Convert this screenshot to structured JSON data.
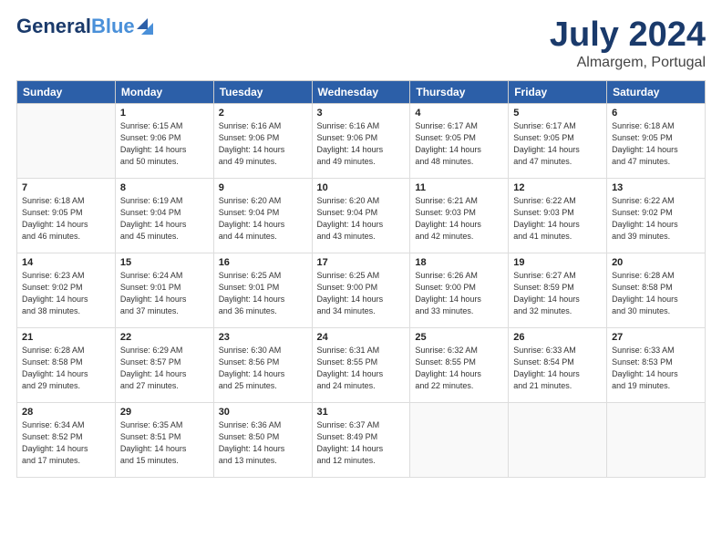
{
  "header": {
    "logo_general": "General",
    "logo_blue": "Blue",
    "main_title": "July 2024",
    "subtitle": "Almargem, Portugal"
  },
  "weekdays": [
    "Sunday",
    "Monday",
    "Tuesday",
    "Wednesday",
    "Thursday",
    "Friday",
    "Saturday"
  ],
  "weeks": [
    [
      {
        "day": "",
        "info": ""
      },
      {
        "day": "1",
        "info": "Sunrise: 6:15 AM\nSunset: 9:06 PM\nDaylight: 14 hours\nand 50 minutes."
      },
      {
        "day": "2",
        "info": "Sunrise: 6:16 AM\nSunset: 9:06 PM\nDaylight: 14 hours\nand 49 minutes."
      },
      {
        "day": "3",
        "info": "Sunrise: 6:16 AM\nSunset: 9:06 PM\nDaylight: 14 hours\nand 49 minutes."
      },
      {
        "day": "4",
        "info": "Sunrise: 6:17 AM\nSunset: 9:05 PM\nDaylight: 14 hours\nand 48 minutes."
      },
      {
        "day": "5",
        "info": "Sunrise: 6:17 AM\nSunset: 9:05 PM\nDaylight: 14 hours\nand 47 minutes."
      },
      {
        "day": "6",
        "info": "Sunrise: 6:18 AM\nSunset: 9:05 PM\nDaylight: 14 hours\nand 47 minutes."
      }
    ],
    [
      {
        "day": "7",
        "info": "Sunrise: 6:18 AM\nSunset: 9:05 PM\nDaylight: 14 hours\nand 46 minutes."
      },
      {
        "day": "8",
        "info": "Sunrise: 6:19 AM\nSunset: 9:04 PM\nDaylight: 14 hours\nand 45 minutes."
      },
      {
        "day": "9",
        "info": "Sunrise: 6:20 AM\nSunset: 9:04 PM\nDaylight: 14 hours\nand 44 minutes."
      },
      {
        "day": "10",
        "info": "Sunrise: 6:20 AM\nSunset: 9:04 PM\nDaylight: 14 hours\nand 43 minutes."
      },
      {
        "day": "11",
        "info": "Sunrise: 6:21 AM\nSunset: 9:03 PM\nDaylight: 14 hours\nand 42 minutes."
      },
      {
        "day": "12",
        "info": "Sunrise: 6:22 AM\nSunset: 9:03 PM\nDaylight: 14 hours\nand 41 minutes."
      },
      {
        "day": "13",
        "info": "Sunrise: 6:22 AM\nSunset: 9:02 PM\nDaylight: 14 hours\nand 39 minutes."
      }
    ],
    [
      {
        "day": "14",
        "info": "Sunrise: 6:23 AM\nSunset: 9:02 PM\nDaylight: 14 hours\nand 38 minutes."
      },
      {
        "day": "15",
        "info": "Sunrise: 6:24 AM\nSunset: 9:01 PM\nDaylight: 14 hours\nand 37 minutes."
      },
      {
        "day": "16",
        "info": "Sunrise: 6:25 AM\nSunset: 9:01 PM\nDaylight: 14 hours\nand 36 minutes."
      },
      {
        "day": "17",
        "info": "Sunrise: 6:25 AM\nSunset: 9:00 PM\nDaylight: 14 hours\nand 34 minutes."
      },
      {
        "day": "18",
        "info": "Sunrise: 6:26 AM\nSunset: 9:00 PM\nDaylight: 14 hours\nand 33 minutes."
      },
      {
        "day": "19",
        "info": "Sunrise: 6:27 AM\nSunset: 8:59 PM\nDaylight: 14 hours\nand 32 minutes."
      },
      {
        "day": "20",
        "info": "Sunrise: 6:28 AM\nSunset: 8:58 PM\nDaylight: 14 hours\nand 30 minutes."
      }
    ],
    [
      {
        "day": "21",
        "info": "Sunrise: 6:28 AM\nSunset: 8:58 PM\nDaylight: 14 hours\nand 29 minutes."
      },
      {
        "day": "22",
        "info": "Sunrise: 6:29 AM\nSunset: 8:57 PM\nDaylight: 14 hours\nand 27 minutes."
      },
      {
        "day": "23",
        "info": "Sunrise: 6:30 AM\nSunset: 8:56 PM\nDaylight: 14 hours\nand 25 minutes."
      },
      {
        "day": "24",
        "info": "Sunrise: 6:31 AM\nSunset: 8:55 PM\nDaylight: 14 hours\nand 24 minutes."
      },
      {
        "day": "25",
        "info": "Sunrise: 6:32 AM\nSunset: 8:55 PM\nDaylight: 14 hours\nand 22 minutes."
      },
      {
        "day": "26",
        "info": "Sunrise: 6:33 AM\nSunset: 8:54 PM\nDaylight: 14 hours\nand 21 minutes."
      },
      {
        "day": "27",
        "info": "Sunrise: 6:33 AM\nSunset: 8:53 PM\nDaylight: 14 hours\nand 19 minutes."
      }
    ],
    [
      {
        "day": "28",
        "info": "Sunrise: 6:34 AM\nSunset: 8:52 PM\nDaylight: 14 hours\nand 17 minutes."
      },
      {
        "day": "29",
        "info": "Sunrise: 6:35 AM\nSunset: 8:51 PM\nDaylight: 14 hours\nand 15 minutes."
      },
      {
        "day": "30",
        "info": "Sunrise: 6:36 AM\nSunset: 8:50 PM\nDaylight: 14 hours\nand 13 minutes."
      },
      {
        "day": "31",
        "info": "Sunrise: 6:37 AM\nSunset: 8:49 PM\nDaylight: 14 hours\nand 12 minutes."
      },
      {
        "day": "",
        "info": ""
      },
      {
        "day": "",
        "info": ""
      },
      {
        "day": "",
        "info": ""
      }
    ]
  ]
}
